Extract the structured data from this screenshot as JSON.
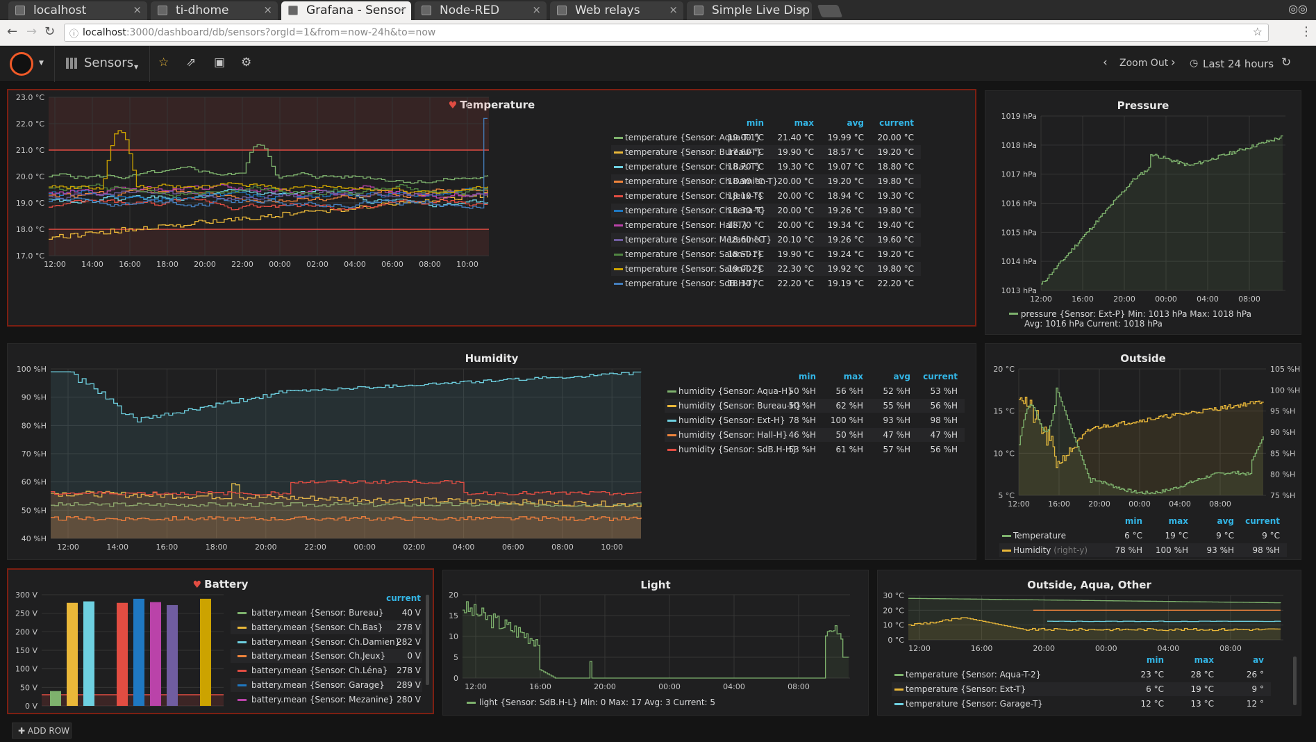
{
  "browser": {
    "tabs": [
      {
        "label": "localhost",
        "active": false,
        "x": 12,
        "w": 200
      },
      {
        "label": "ti-dhome",
        "active": false,
        "x": 217,
        "w": 183
      },
      {
        "label": "Grafana - Sensor",
        "active": true,
        "x": 405,
        "w": 187
      },
      {
        "label": "Node-RED",
        "active": false,
        "x": 597,
        "w": 190
      },
      {
        "label": "Web relays",
        "active": false,
        "x": 792,
        "w": 192
      },
      {
        "label": "Simple Live Disp",
        "active": false,
        "x": 989,
        "w": 180
      }
    ],
    "url_host": "localhost",
    "url_path": ":3000/dashboard/db/sensors?orgId=1&from=now-24h&to=now"
  },
  "nav": {
    "dashboard": "Sensors",
    "zoom_out": "Zoom Out",
    "time_range": "Last 24 hours"
  },
  "temperature": {
    "title": "Temperature",
    "headers": [
      "min",
      "max",
      "avg",
      "current"
    ],
    "y_ticks": [
      "23.0 °C",
      "22.0 °C",
      "21.0 °C",
      "20.0 °C",
      "19.0 °C",
      "18.0 °C",
      "17.0 °C"
    ],
    "x_ticks": [
      "12:00",
      "14:00",
      "16:00",
      "18:00",
      "20:00",
      "22:00",
      "00:00",
      "02:00",
      "04:00",
      "06:00",
      "08:00",
      "10:00"
    ],
    "series": [
      {
        "name": "temperature {Sensor: Aqua-T-1}",
        "color": "#7eb26d",
        "min": "19.00 °C",
        "max": "21.40 °C",
        "avg": "19.99 °C",
        "current": "20.00 °C"
      },
      {
        "name": "temperature {Sensor: Bureau-T}",
        "color": "#eab839",
        "min": "17.60 °C",
        "max": "19.90 °C",
        "avg": "18.57 °C",
        "current": "19.20 °C"
      },
      {
        "name": "temperature {Sensor: Ch.Bas-T}",
        "color": "#6ed0e0",
        "min": "18.70 °C",
        "max": "19.30 °C",
        "avg": "19.07 °C",
        "current": "18.80 °C"
      },
      {
        "name": "temperature {Sensor: Ch.Damien-T}",
        "color": "#ef843c",
        "min": "18.30 °C",
        "max": "20.00 °C",
        "avg": "19.20 °C",
        "current": "19.80 °C"
      },
      {
        "name": "temperature {Sensor: Ch.Jeux-T}",
        "color": "#e24d42",
        "min": "18.10 °C",
        "max": "20.00 °C",
        "avg": "18.94 °C",
        "current": "19.30 °C"
      },
      {
        "name": "temperature {Sensor: Ch.Lena-T}",
        "color": "#1f78c1",
        "min": "18.30 °C",
        "max": "20.00 °C",
        "avg": "19.26 °C",
        "current": "19.80 °C"
      },
      {
        "name": "temperature {Sensor: Hall-T}",
        "color": "#ba43a9",
        "min": "18.70 °C",
        "max": "20.00 °C",
        "avg": "19.34 °C",
        "current": "19.40 °C"
      },
      {
        "name": "temperature {Sensor: Mezanine-T}",
        "color": "#705da0",
        "min": "18.60 °C",
        "max": "20.10 °C",
        "avg": "19.26 °C",
        "current": "19.60 °C"
      },
      {
        "name": "temperature {Sensor: Salon-T-1}",
        "color": "#508642",
        "min": "18.50 °C",
        "max": "19.90 °C",
        "avg": "19.24 °C",
        "current": "19.20 °C"
      },
      {
        "name": "temperature {Sensor: Salon-T-2}",
        "color": "#cca300",
        "min": "19.00 °C",
        "max": "22.30 °C",
        "avg": "19.92 °C",
        "current": "19.80 °C"
      },
      {
        "name": "temperature {Sensor: SdB.H-T}",
        "color": "#447ebc",
        "min": "18.30 °C",
        "max": "22.20 °C",
        "avg": "19.19 °C",
        "current": "22.20 °C"
      }
    ]
  },
  "pressure": {
    "title": "Pressure",
    "y_ticks": [
      "1019 hPa",
      "1018 hPa",
      "1017 hPa",
      "1016 hPa",
      "1015 hPa",
      "1014 hPa",
      "1013 hPa"
    ],
    "x_ticks": [
      "12:00",
      "16:00",
      "20:00",
      "00:00",
      "04:00",
      "08:00"
    ],
    "legend1": "pressure {Sensor: Ext-P}  Min: 1013 hPa  Max: 1018 hPa",
    "legend2": "Avg: 1016 hPa  Current: 1018 hPa",
    "color": "#7eb26d"
  },
  "humidity": {
    "title": "Humidity",
    "headers": [
      "min",
      "max",
      "avg",
      "current"
    ],
    "y_ticks": [
      "100 %H",
      "90 %H",
      "80 %H",
      "70 %H",
      "60 %H",
      "50 %H",
      "40 %H"
    ],
    "x_ticks": [
      "12:00",
      "14:00",
      "16:00",
      "18:00",
      "20:00",
      "22:00",
      "00:00",
      "02:00",
      "04:00",
      "06:00",
      "08:00",
      "10:00"
    ],
    "series": [
      {
        "name": "humidity {Sensor: Aqua-H}",
        "color": "#7eb26d",
        "min": "50 %H",
        "max": "56 %H",
        "avg": "52 %H",
        "current": "53 %H"
      },
      {
        "name": "humidity {Sensor: Bureau-H}",
        "color": "#eab839",
        "min": "50 %H",
        "max": "62 %H",
        "avg": "55 %H",
        "current": "56 %H"
      },
      {
        "name": "humidity {Sensor: Ext-H}",
        "color": "#6ed0e0",
        "min": "78 %H",
        "max": "100 %H",
        "avg": "93 %H",
        "current": "98 %H"
      },
      {
        "name": "humidity {Sensor: Hall-H}",
        "color": "#ef843c",
        "min": "46 %H",
        "max": "50 %H",
        "avg": "47 %H",
        "current": "47 %H"
      },
      {
        "name": "humidity {Sensor: SdB.H-H}",
        "color": "#e24d42",
        "min": "53 %H",
        "max": "61 %H",
        "avg": "57 %H",
        "current": "56 %H"
      }
    ]
  },
  "outside": {
    "title": "Outside",
    "headers": [
      "min",
      "max",
      "avg",
      "current"
    ],
    "y_left": [
      "20 °C",
      "15 °C",
      "10 °C",
      "5 °C"
    ],
    "y_right": [
      "105 %H",
      "100 %H",
      "95 %H",
      "90 %H",
      "85 %H",
      "80 %H",
      "75 %H"
    ],
    "x_ticks": [
      "12:00",
      "16:00",
      "20:00",
      "00:00",
      "04:00",
      "08:00"
    ],
    "series": [
      {
        "name": "Temperature",
        "suffix": "",
        "color": "#7eb26d",
        "min": "6 °C",
        "max": "19 °C",
        "avg": "9 °C",
        "current": "9 °C"
      },
      {
        "name": "Humidity",
        "suffix": "(right-y)",
        "color": "#eab839",
        "min": "78 %H",
        "max": "100 %H",
        "avg": "93 %H",
        "current": "98 %H"
      }
    ]
  },
  "battery": {
    "title": "Battery",
    "header": "current",
    "y_ticks": [
      "300 V",
      "250 V",
      "200 V",
      "150 V",
      "100 V",
      "50 V",
      "0 V"
    ],
    "series": [
      {
        "name": "battery.mean {Sensor: Bureau}",
        "color": "#7eb26d",
        "current": "40 V"
      },
      {
        "name": "battery.mean {Sensor: Ch.Bas}",
        "color": "#eab839",
        "current": "278 V"
      },
      {
        "name": "battery.mean {Sensor: Ch.Damien}",
        "color": "#6ed0e0",
        "current": "282 V"
      },
      {
        "name": "battery.mean {Sensor: Ch.Jeux}",
        "color": "#ef843c",
        "current": "0 V"
      },
      {
        "name": "battery.mean {Sensor: Ch.Léna}",
        "color": "#e24d42",
        "current": "278 V"
      },
      {
        "name": "battery.mean {Sensor: Garage}",
        "color": "#1f78c1",
        "current": "289 V"
      },
      {
        "name": "battery.mean {Sensor: Mezanine}",
        "color": "#ba43a9",
        "current": "280 V"
      }
    ]
  },
  "light": {
    "title": "Light",
    "y_ticks": [
      "20",
      "15",
      "10",
      "5",
      "0"
    ],
    "x_ticks": [
      "12:00",
      "16:00",
      "20:00",
      "00:00",
      "04:00",
      "08:00"
    ],
    "legend": "light {Sensor: SdB.H-L}  Min: 0  Max: 17  Avg: 3  Current: 5",
    "color": "#7eb26d"
  },
  "other": {
    "title": "Outside, Aqua, Other",
    "headers": [
      "min",
      "max",
      "av"
    ],
    "y_ticks": [
      "30 °C",
      "20 °C",
      "10 °C",
      "0 °C"
    ],
    "x_ticks": [
      "12:00",
      "16:00",
      "20:00",
      "00:00",
      "04:00",
      "08:00"
    ],
    "series": [
      {
        "name": "temperature {Sensor: Aqua-T-2}",
        "color": "#7eb26d",
        "min": "23 °C",
        "max": "28 °C",
        "avg": "26 °"
      },
      {
        "name": "temperature {Sensor: Ext-T}",
        "color": "#eab839",
        "min": "6 °C",
        "max": "19 °C",
        "avg": "9 °"
      },
      {
        "name": "temperature {Sensor: Garage-T}",
        "color": "#6ed0e0",
        "min": "12 °C",
        "max": "13 °C",
        "avg": "12 °"
      }
    ]
  },
  "add_row": "ADD ROW"
}
